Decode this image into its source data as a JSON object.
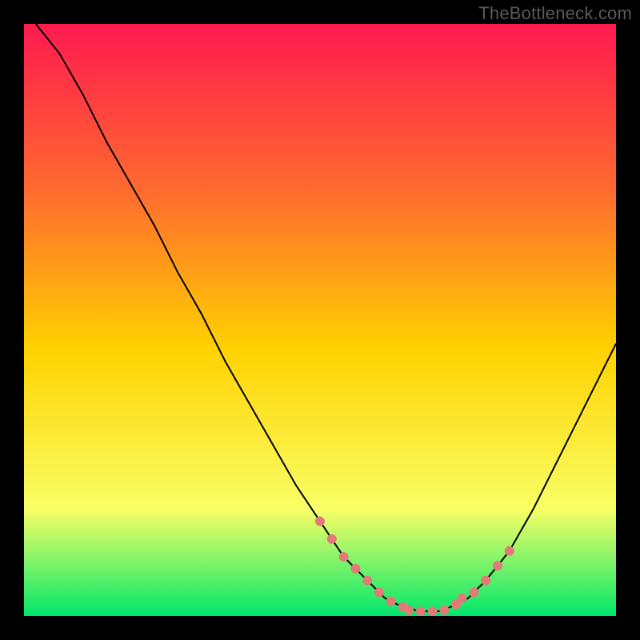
{
  "watermark": "TheBottleneck.com",
  "colors": {
    "bg": "#000000",
    "gradient_top": "#ff1a50",
    "gradient_mid_upper": "#ff6a2f",
    "gradient_mid": "#ffd200",
    "gradient_low": "#f9ff66",
    "gradient_bottom": "#00e76b",
    "curve": "#000000",
    "points": "#e37a7a",
    "watermark": "#595959"
  },
  "chart_data": {
    "type": "line",
    "title": "",
    "xlabel": "",
    "ylabel": "",
    "xlim": [
      0,
      100
    ],
    "ylim": [
      0,
      100
    ],
    "grid": false,
    "series": [
      {
        "name": "bottleneck_curve",
        "x": [
          2,
          6,
          10,
          14,
          18,
          22,
          26,
          30,
          34,
          38,
          42,
          46,
          50,
          54,
          58,
          61,
          64,
          67,
          70,
          72,
          75,
          78,
          82,
          86,
          90,
          94,
          98,
          100
        ],
        "y": [
          100,
          95,
          88,
          80,
          73,
          66,
          58,
          51,
          43,
          36,
          29,
          22,
          16,
          10,
          6,
          3,
          1.5,
          0.8,
          0.8,
          1.5,
          3,
          6,
          11,
          18,
          26,
          34,
          42,
          46
        ]
      }
    ],
    "highlight_points": {
      "name": "highlighted_range",
      "x": [
        50,
        52,
        54,
        56,
        58,
        60,
        62,
        64,
        65,
        67,
        69,
        71,
        73,
        74,
        76,
        78,
        80,
        82
      ],
      "y": [
        16,
        13,
        10,
        8,
        6,
        4,
        2.5,
        1.5,
        1,
        0.8,
        0.8,
        1,
        2,
        3,
        4,
        6,
        8.5,
        11
      ]
    }
  }
}
